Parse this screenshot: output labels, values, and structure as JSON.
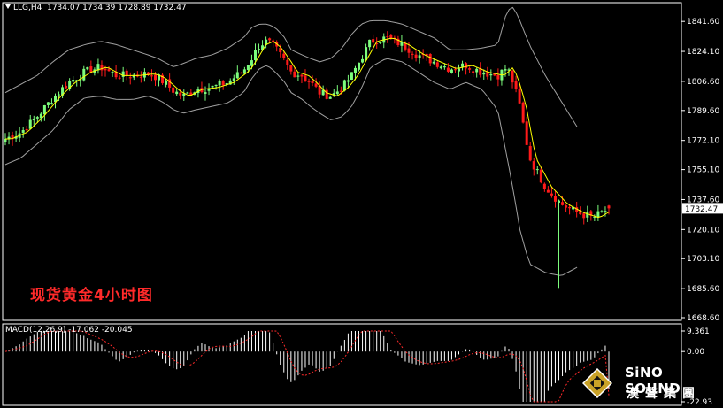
{
  "header": {
    "symbol": "LLG,H4",
    "ohlc": "1734.07 1734.39 1728.89 1732.47"
  },
  "caption": "现货黄金4小时图",
  "macd_label": "MACD(12,26,9) -17.062 -20.045",
  "current_price": "1732.47",
  "logo": {
    "en": "SiNO SOUND",
    "cn": "漢聲集團"
  },
  "colors": {
    "up": "#7CFC7C",
    "down": "#ff1a1a",
    "ma": "#ffff00",
    "band": "#a0a0a0",
    "macd_hist": "#ffffff",
    "macd_signal": "#ff2a2a",
    "grid_text": "#ffffff"
  },
  "chart_data": [
    {
      "type": "candlestick",
      "title": "",
      "yticks": [
        "1841.60",
        "1824.10",
        "1806.60",
        "1789.60",
        "1772.10",
        "1755.10",
        "1737.60",
        "1720.10",
        "1703.10",
        "1685.60",
        "1668.60"
      ],
      "ylim": [
        1668.6,
        1851.0
      ],
      "indicators": [
        "Moving Average",
        "Bollinger Bands"
      ],
      "anchors": {
        "x": [
          0,
          10,
          20,
          30,
          40,
          50,
          60,
          70,
          80,
          90,
          96,
          100,
          106,
          112,
          120,
          130,
          140,
          150,
          155,
          160,
          165,
          170,
          176,
          180,
          187,
          192,
          198,
          205,
          212,
          218,
          224,
          230,
          240,
          250,
          260,
          270,
          280,
          290,
          300,
          310,
          316,
          320,
          324,
          330,
          340,
          350,
          360,
          370,
          380
        ],
        "close": [
          1773,
          1777,
          1786,
          1797,
          1806,
          1812,
          1815,
          1810,
          1810,
          1811,
          1809,
          1806,
          1801,
          1798,
          1802,
          1803,
          1806,
          1813,
          1820,
          1828,
          1830,
          1826,
          1818,
          1812,
          1810,
          1806,
          1800,
          1798,
          1803,
          1810,
          1820,
          1830,
          1832,
          1828,
          1822,
          1818,
          1814,
          1816,
          1812,
          1810,
          1815,
          1805,
          1792,
          1762,
          1745,
          1735,
          1730,
          1727,
          1732.47
        ],
        "upper": [
          1800,
          1805,
          1810,
          1818,
          1825,
          1828,
          1830,
          1828,
          1825,
          1822,
          1820,
          1818,
          1815,
          1817,
          1820,
          1822,
          1826,
          1832,
          1838,
          1840,
          1840,
          1838,
          1832,
          1825,
          1822,
          1820,
          1818,
          1820,
          1826,
          1834,
          1840,
          1842,
          1842,
          1840,
          1836,
          1832,
          1825,
          1825,
          1826,
          1828,
          1848,
          1850,
          1842,
          1828,
          1810,
          1795,
          1780
        ],
        "lower": [
          1758,
          1762,
          1770,
          1778,
          1790,
          1797,
          1798,
          1796,
          1796,
          1798,
          1796,
          1794,
          1790,
          1788,
          1790,
          1792,
          1794,
          1800,
          1808,
          1814,
          1816,
          1812,
          1806,
          1800,
          1796,
          1792,
          1788,
          1784,
          1786,
          1792,
          1802,
          1815,
          1820,
          1818,
          1812,
          1806,
          1802,
          1806,
          1802,
          1790,
          1762,
          1742,
          1720,
          1700,
          1695,
          1693,
          1698
        ]
      },
      "last": {
        "open": 1734.07,
        "high": 1734.39,
        "low": 1728.89,
        "close": 1732.47
      }
    },
    {
      "type": "macd",
      "label": "MACD(12,26,9) -17.062 -20.045",
      "macd": -17.062,
      "signal": -20.045,
      "yticks": [
        "9.361",
        "0.00",
        "-22.93"
      ],
      "ylim": [
        -22.93,
        9.361
      ]
    }
  ]
}
